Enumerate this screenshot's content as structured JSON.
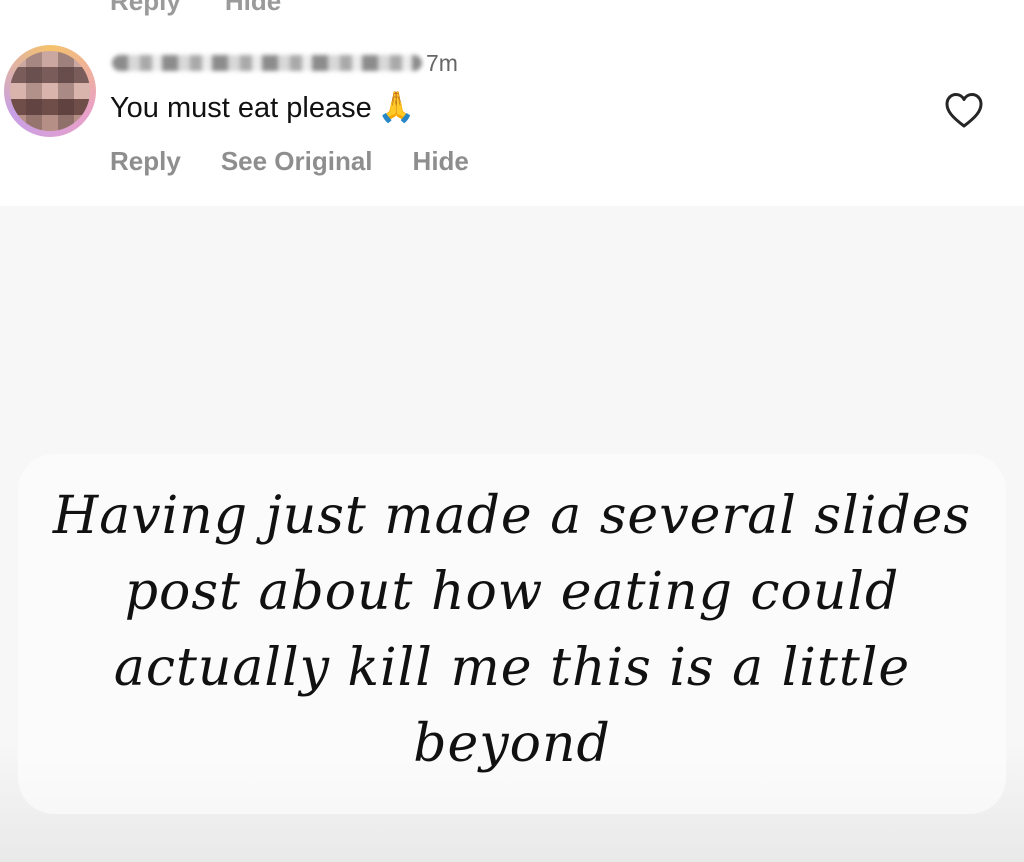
{
  "previous_comment": {
    "actions": [
      "Reply",
      "Hide"
    ]
  },
  "comment": {
    "timestamp": "7m",
    "text": "You must eat please",
    "emoji": "🙏",
    "actions": {
      "reply": "Reply",
      "see_original": "See Original",
      "hide": "Hide"
    },
    "like_icon": "heart-outline-icon"
  },
  "slide": {
    "text": "Having just made a several slides post about how eating could actually kill me this is a little beyond"
  },
  "colors": {
    "action_text": "#8e8e8e",
    "comment_text": "#111111",
    "slide_background": "#f7f7f7"
  }
}
